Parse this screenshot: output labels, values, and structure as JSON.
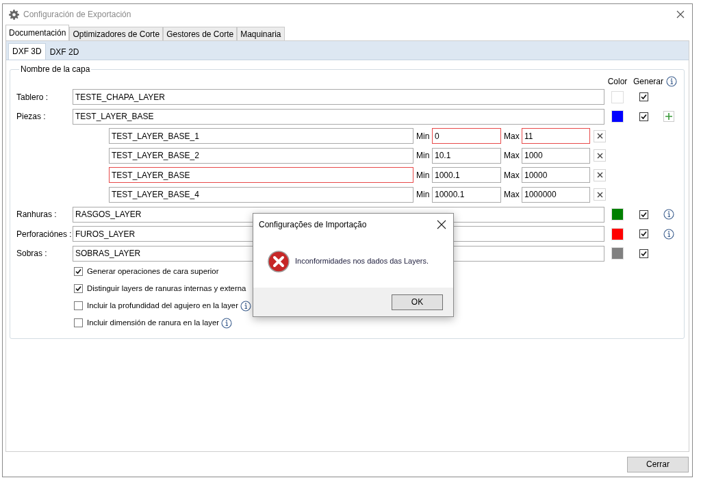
{
  "window": {
    "title": "Configuración de Exportación"
  },
  "tabs": [
    {
      "label": "Documentación",
      "selected": true
    },
    {
      "label": "Optimizadores de Corte",
      "selected": false
    },
    {
      "label": "Gestores de Corte",
      "selected": false
    },
    {
      "label": "Maquinaria",
      "selected": false
    }
  ],
  "subtabs": [
    {
      "label": "DXF 3D",
      "selected": true
    },
    {
      "label": "DXF 2D",
      "selected": false
    }
  ],
  "group": {
    "title": "Nombre de la capa",
    "headers": {
      "swatch_column": "Color",
      "generate_column": "Generar"
    },
    "layers": [
      {
        "label": "Tablero :",
        "value": "TESTE_CHAPA_LAYER",
        "color": "#ffffff",
        "generate": true
      },
      {
        "label": "Piezas :",
        "value": "TEST_LAYER_BASE",
        "color": "#0000ff",
        "generate": true,
        "addable": true,
        "sublayers": [
          {
            "value": "TEST_LAYER_BASE_1",
            "name_invalid": false,
            "min_label": "Min",
            "min": "0",
            "min_invalid": true,
            "max_label": "Max",
            "max": "11",
            "max_invalid": true
          },
          {
            "value": "TEST_LAYER_BASE_2",
            "name_invalid": false,
            "min_label": "Min",
            "min": "10.1",
            "min_invalid": false,
            "max_label": "Max",
            "max": "1000",
            "max_invalid": false
          },
          {
            "value": "TEST_LAYER_BASE",
            "name_invalid": true,
            "min_label": "Min",
            "min": "1000.1",
            "min_invalid": false,
            "max_label": "Max",
            "max": "10000",
            "max_invalid": false
          },
          {
            "value": "TEST_LAYER_BASE_4",
            "name_invalid": false,
            "min_label": "Min",
            "min": "10000.1",
            "min_invalid": false,
            "max_label": "Max",
            "max": "1000000",
            "max_invalid": false
          }
        ]
      },
      {
        "label": "Ranhuras :",
        "value": "RASGOS_LAYER",
        "color": "#008000",
        "generate": true,
        "has_info": true
      },
      {
        "label": "Perforaciónes :",
        "value": "FUROS_LAYER",
        "color": "#ff0000",
        "generate": true,
        "has_info": true
      },
      {
        "label": "Sobras :",
        "value": "SOBRAS_LAYER",
        "color": "#808080",
        "generate": true
      }
    ],
    "options": [
      {
        "label": "Generar operaciones de cara superior",
        "checked": true,
        "info": false
      },
      {
        "label": "Distinguir layers de ranuras internas y externa",
        "checked": true,
        "info": false
      },
      {
        "label": "Incluir la profundidad del agujero en la layer",
        "checked": false,
        "info": true
      },
      {
        "label": "Incluir dimensión de ranura en la layer",
        "checked": false,
        "info": true
      }
    ]
  },
  "close_button": "Cerrar",
  "dialog": {
    "title": "Configurações de Importação",
    "message": "Inconformidades nos dados das Layers.",
    "button": "OK"
  }
}
